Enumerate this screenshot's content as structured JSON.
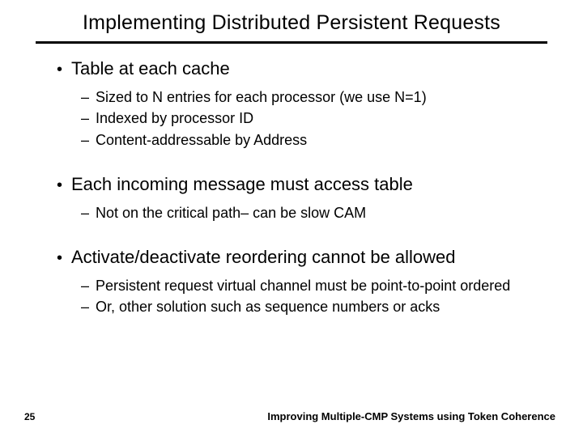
{
  "title": "Implementing Distributed Persistent Requests",
  "bullets": [
    {
      "text": "Table at each cache",
      "sub": [
        "Sized to N entries for each processor (we use N=1)",
        "Indexed by processor ID",
        "Content-addressable by Address"
      ]
    },
    {
      "text": "Each incoming message must access table",
      "sub": [
        "Not on the critical path– can be slow CAM"
      ]
    },
    {
      "text": "Activate/deactivate reordering cannot be allowed",
      "sub": [
        "Persistent request virtual channel must be point-to-point ordered",
        "Or, other solution such as sequence numbers or acks"
      ]
    }
  ],
  "page_number": "25",
  "footer": "Improving Multiple-CMP Systems using Token Coherence"
}
